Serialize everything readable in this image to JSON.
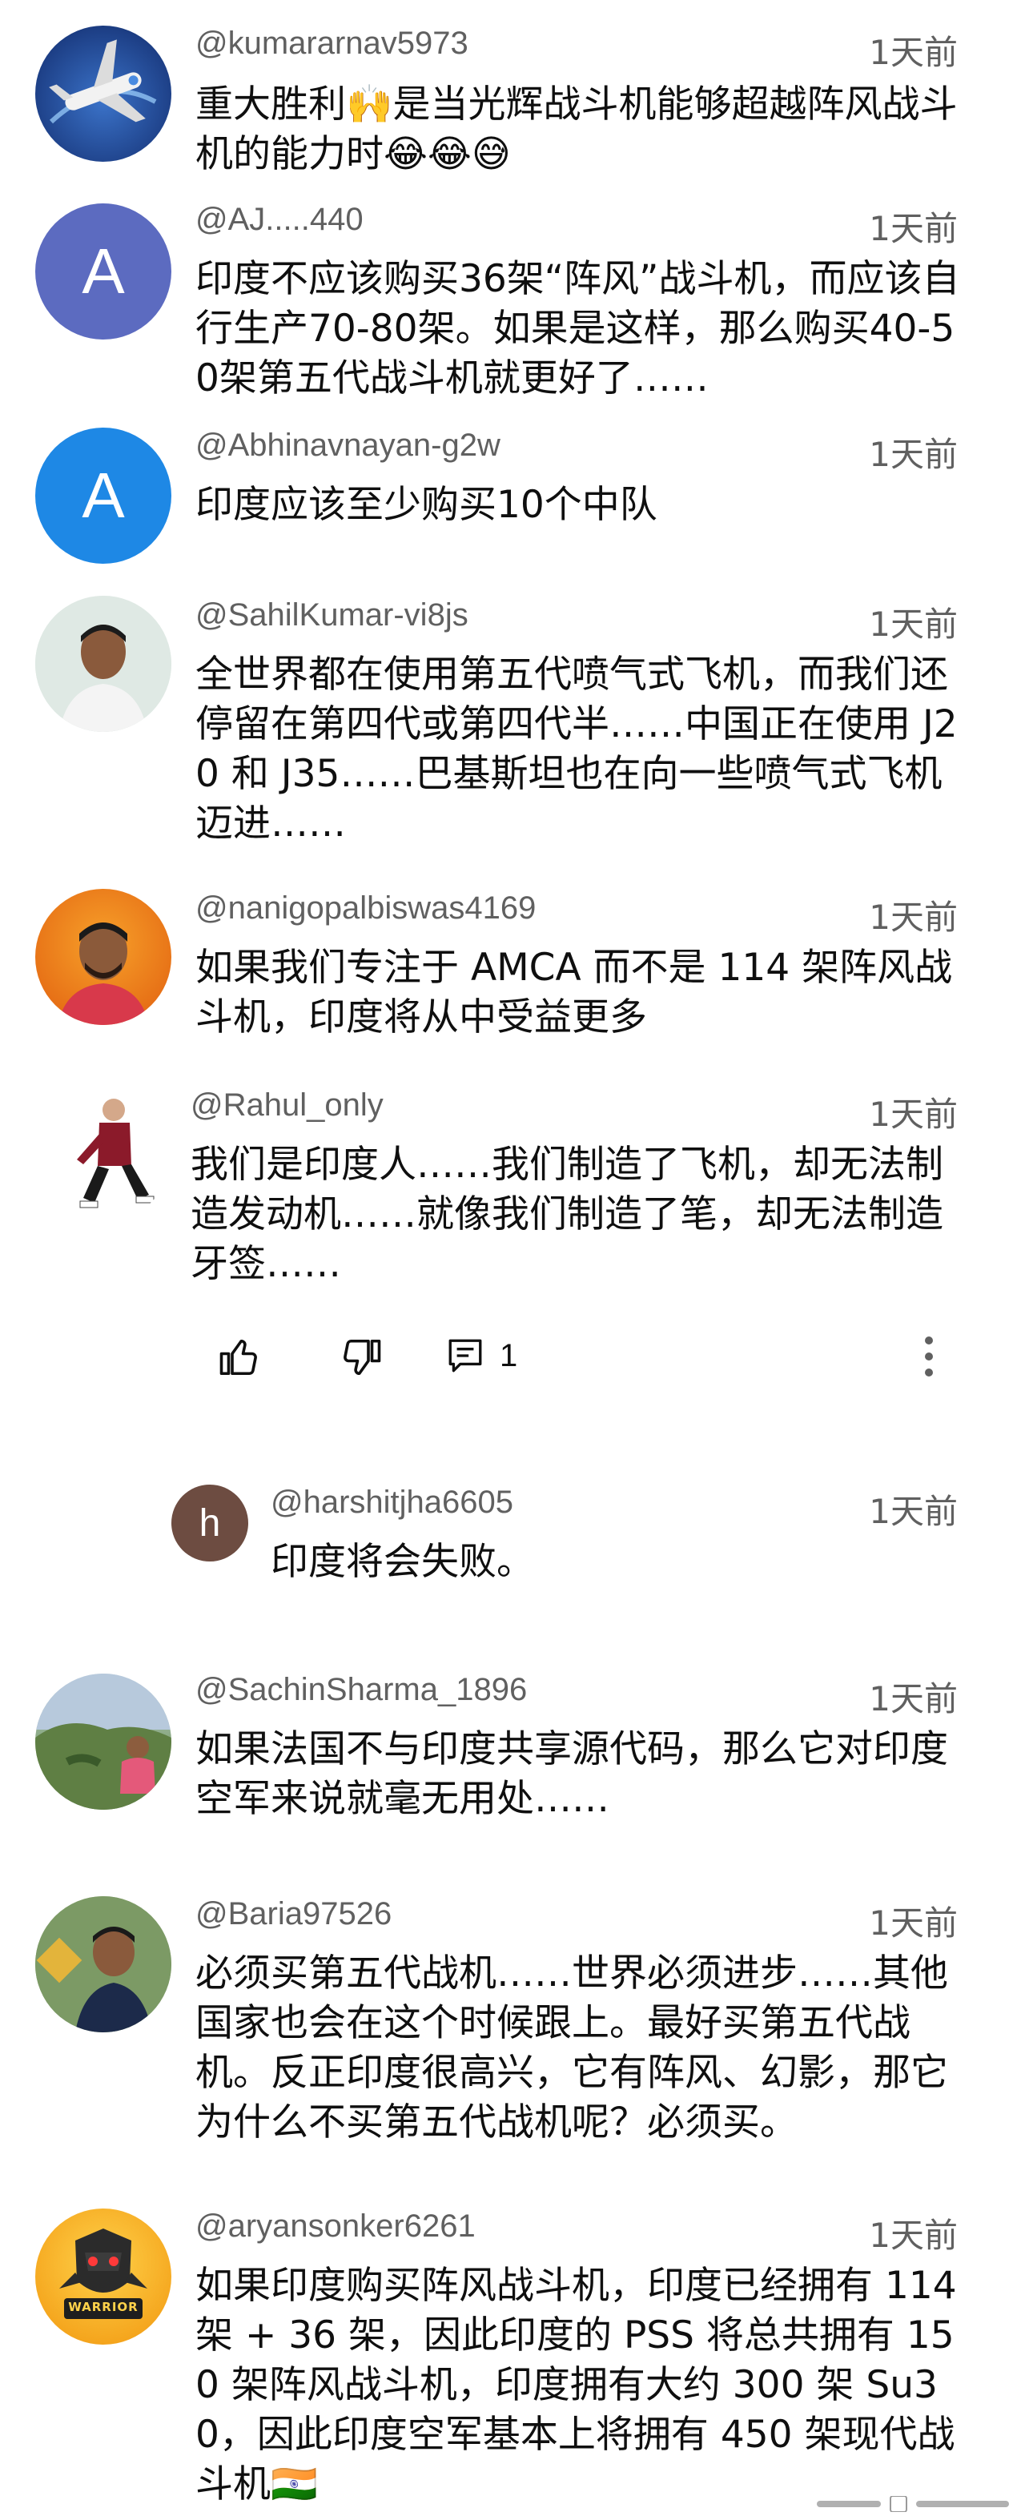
{
  "comments": [
    {
      "handle": "@kumararnav5973",
      "time": "1天前",
      "text": "重大胜利🙌是当光辉战斗机能够超越阵风战斗机的能力时😂😂😅",
      "avatar": "airplane-avatar"
    },
    {
      "handle": "@AJ.....440",
      "time": "1天前",
      "text": "印度不应该购买36架“阵风”战斗机，而应该自行生产70-80架。如果是这样，那么购买40-50架第五代战斗机就更好了……",
      "avatar_letter": "A",
      "avatar_color": "#5c6bc0"
    },
    {
      "handle": "@Abhinavnayan-g2w",
      "time": "1天前",
      "text": "印度应该至少购买10个中队",
      "avatar_letter": "A",
      "avatar_color": "#1e88e5"
    },
    {
      "handle": "@SahilKumar-vi8js",
      "time": "1天前",
      "text": "全世界都在使用第五代喷气式飞机，而我们还停留在第四代或第四代半……中国正在使用 J20 和 J35……巴基斯坦也在向一些喷气式飞机迈进……",
      "avatar": "photo-avatar"
    },
    {
      "handle": "@nanigopalbiswas4169",
      "time": "1天前",
      "text": "如果我们专注于 AMCA 而不是 114 架阵风战斗机，印度将从中受益更多",
      "avatar": "photo-avatar"
    },
    {
      "handle": "@Rahul_only",
      "time": "1天前",
      "text": "我们是印度人……我们制造了飞机，却无法制造发动机……就像我们制造了笔，却无法制造牙签……",
      "avatar": "photo-avatar"
    },
    {
      "handle": "@harshitjha6605",
      "time": "1天前",
      "text": "印度将会失败。",
      "avatar_letter": "h",
      "avatar_color": "#6d4c41"
    },
    {
      "handle": "@SachinSharma_1896",
      "time": "1天前",
      "text": "如果法国不与印度共享源代码，那么它对印度空军来说就毫无用处……",
      "avatar": "photo-avatar"
    },
    {
      "handle": "@Baria97526",
      "time": "1天前",
      "text": "必须买第五代战机……世界必须进步……其他国家也会在这个时候跟上。最好买第五代战机。反正印度很高兴，它有阵风、幻影，那它为什么不买第五代战机呢？必须买。",
      "avatar": "photo-avatar"
    },
    {
      "handle": "@aryansonker6261",
      "time": "1天前",
      "text": "如果印度购买阵风战斗机，印度已经拥有 114 架 + 36 架，因此印度的 PSS 将总共拥有 150 架阵风战斗机，印度拥有大约 300 架 Su30，因此印度空军基本上将拥有 450 架现代战斗机🇮🇳",
      "avatar": "warrior-logo-avatar",
      "logo_text": "WARRIOR"
    }
  ],
  "actions": {
    "reply_count": "1"
  }
}
